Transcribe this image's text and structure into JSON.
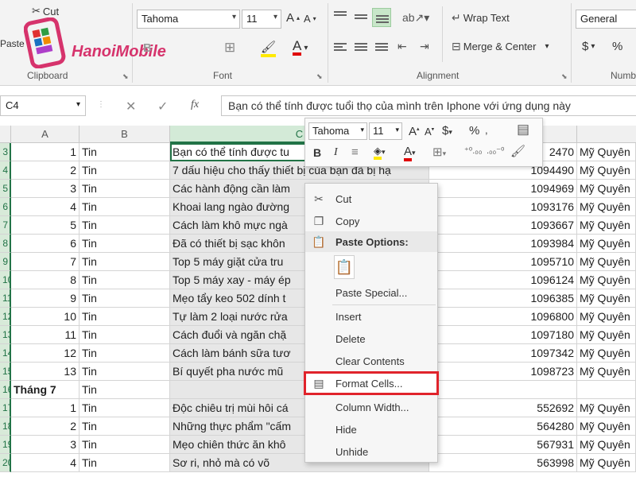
{
  "ribbon": {
    "clipboard": {
      "cut_label": "Cut",
      "paste_label": "Paste",
      "group_label": "Clipboard"
    },
    "font": {
      "font_name": "Tahoma",
      "font_size": "11",
      "group_label": "Font"
    },
    "alignment": {
      "wrap_text_label": "Wrap Text",
      "merge_label": "Merge & Center",
      "group_label": "Alignment"
    },
    "number": {
      "format_value": "General",
      "currency_symbol": "$",
      "percent_symbol": "%",
      "group_label": "Numb"
    }
  },
  "logo": {
    "text": "HanoiMobile"
  },
  "formula_bar": {
    "name_box": "C4",
    "fx_label": "fx",
    "content": "Bạn có thể tính được tuổi thọ của mình trên Iphone với ứng dụng này"
  },
  "columns": {
    "a": "A",
    "b": "B",
    "c": "C"
  },
  "rows": [
    {
      "rh": "3",
      "a": "1",
      "b": "Tin",
      "c": "Bạn có thể tính được tu",
      "e": "2470",
      "f": "Mỹ Quyên"
    },
    {
      "rh": "4",
      "a": "2",
      "b": "Tin",
      "c": "7 dấu hiệu cho thấy thiết bị của bạn đã bị hạ",
      "e": "1094490",
      "f": "Mỹ Quyên"
    },
    {
      "rh": "5",
      "a": "3",
      "b": "Tin",
      "c": "Các hành động cần làm",
      "e": "1094969",
      "f": "Mỹ Quyên"
    },
    {
      "rh": "6",
      "a": "4",
      "b": "Tin",
      "c": "Khoai lang ngào đường",
      "e": "1093176",
      "f": "Mỹ Quyên"
    },
    {
      "rh": "7",
      "a": "5",
      "b": "Tin",
      "c": "Cách làm khô mực ngà",
      "e": "1093667",
      "f": "Mỹ Quyên"
    },
    {
      "rh": "8",
      "a": "6",
      "b": "Tin",
      "c": "Đã có thiết bị sạc khôn",
      "e": "1093984",
      "f": "Mỹ Quyên"
    },
    {
      "rh": "9",
      "a": "7",
      "b": "Tin",
      "c": "Top 5 máy giặt cửa tru",
      "e": "1095710",
      "f": "Mỹ Quyên"
    },
    {
      "rh": "10",
      "a": "8",
      "b": "Tin",
      "c": "Top 5 máy xay - máy ép",
      "e": "1096124",
      "f": "Mỹ Quyên"
    },
    {
      "rh": "11",
      "a": "9",
      "b": "Tin",
      "c": "Mẹo tẩy keo 502 dính t",
      "e": "1096385",
      "f": "Mỹ Quyên"
    },
    {
      "rh": "12",
      "a": "10",
      "b": "Tin",
      "c": "Tự làm 2 loại nước rửa",
      "e": "1096800",
      "f": "Mỹ Quyên"
    },
    {
      "rh": "13",
      "a": "11",
      "b": "Tin",
      "c": "Cách đuổi và ngăn chặ",
      "e": "1097180",
      "f": "Mỹ Quyên"
    },
    {
      "rh": "14",
      "a": "12",
      "b": "Tin",
      "c": "Cách làm bánh sữa tươ",
      "e": "1097342",
      "f": "Mỹ Quyên"
    },
    {
      "rh": "15",
      "a": "13",
      "b": "Tin",
      "c": "Bí quyết pha nước mũ",
      "e": "1098723",
      "f": "Mỹ Quyên"
    },
    {
      "rh": "16",
      "a": "Tháng 7",
      "b": "Tin",
      "c": "",
      "e": "",
      "f": ""
    },
    {
      "rh": "17",
      "a": "1",
      "b": "Tin",
      "c": "Độc chiêu trị mùi hôi cá",
      "e": "552692",
      "f": "Mỹ Quyên"
    },
    {
      "rh": "18",
      "a": "2",
      "b": "Tin",
      "c": "Những thực phẩm \"cấm",
      "e": "564280",
      "f": "Mỹ Quyên"
    },
    {
      "rh": "19",
      "a": "3",
      "b": "Tin",
      "c": "Mẹo chiên thức ăn khô",
      "e": "567931",
      "f": "Mỹ Quyên"
    },
    {
      "rh": "20",
      "a": "4",
      "b": "Tin",
      "c": "Sơ ri, nhỏ mà có võ",
      "e": "563998",
      "f": "Mỹ Quyên"
    }
  ],
  "mini_toolbar": {
    "font_name": "Tahoma",
    "font_size": "11",
    "bold": "B",
    "italic": "I",
    "currency": "$",
    "percent": "%"
  },
  "context_menu": {
    "cut": "Cut",
    "copy": "Copy",
    "paste_options": "Paste Options:",
    "paste_special": "Paste Special...",
    "insert": "Insert",
    "delete": "Delete",
    "clear_contents": "Clear Contents",
    "format_cells": "Format Cells...",
    "column_width": "Column Width...",
    "hide": "Hide",
    "unhide": "Unhide"
  },
  "colors": {
    "excel_green": "#217346",
    "highlight_red": "#e0232b",
    "logo_pink": "#d6336c"
  }
}
